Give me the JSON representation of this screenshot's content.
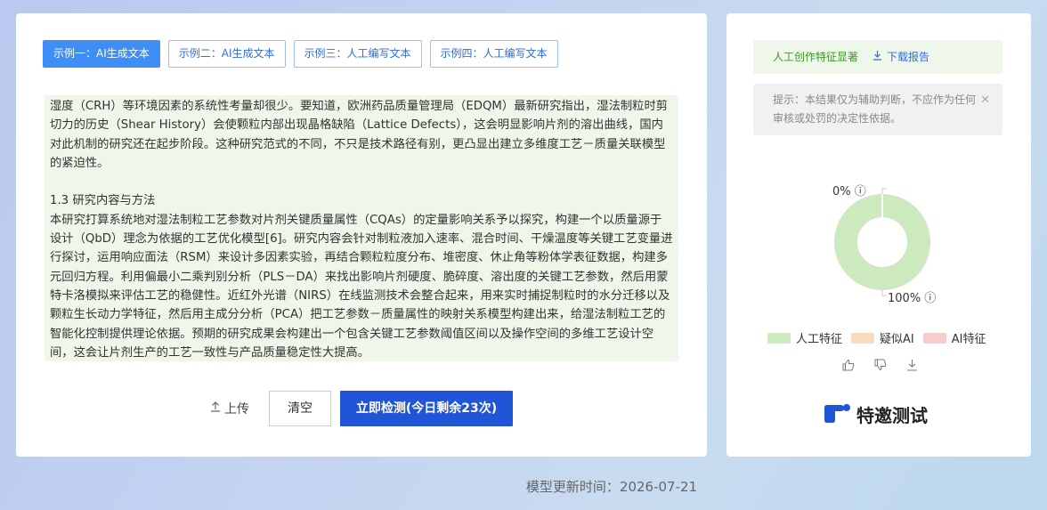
{
  "tabs": [
    {
      "label": "示例一：AI生成文本",
      "active": true
    },
    {
      "label": "示例二：AI生成文本",
      "active": false
    },
    {
      "label": "示例三：人工编写文本",
      "active": false
    },
    {
      "label": "示例四：人工编写文本",
      "active": false
    }
  ],
  "content": {
    "para1": "湿度（CRH）等环境因素的系统性考量却很少。要知道，欧洲药品质量管理局（EDQM）最新研究指出，湿法制粒时剪切力的历史（Shear History）会使颗粒内部出现晶格缺陷（Lattice Defects），这会明显影响片剂的溶出曲线，国内对此机制的研究还在起步阶段。这种研究范式的不同，不只是技术路径有别，更凸显出建立多维度工艺－质量关联模型的紧迫性。",
    "heading": "1.3 研究内容与方法",
    "para2": "本研究打算系统地对湿法制粒工艺参数对片剂关键质量属性（CQAs）的定量影响关系予以探究，构建一个以质量源于设计（QbD）理念为依据的工艺优化模型[6]。研究内容会针对制粒液加入速率、混合时间、干燥温度等关键工艺变量进行探讨，运用响应面法（RSM）来设计多因素实验，再结合颗粒粒度分布、堆密度、休止角等粉体学表征数据，构建多元回归方程。利用偏最小二乘判别分析（PLS－DA）来找出影响片剂硬度、脆碎度、溶出度的关键工艺参数，然后用蒙特卡洛模拟来评估工艺的稳健性。近红外光谱（NIRS）在线监测技术会整合起来，用来实时捕捉制粒时的水分迁移以及颗粒生长动力学特征，然后用主成分分析（PCA）把工艺参数－质量属性的映射关系模型构建出来，给湿法制粒工艺的智能化控制提供理论依据。预期的研究成果会构建出一个包含关键工艺参数阈值区间以及操作空间的多维工艺设计空间，这会让片剂生产的工艺一致性与产品质量稳定性大提高。"
  },
  "actions": {
    "upload_label": "上传",
    "clear_label": "清空",
    "detect_label": "立即检测(今日剩余23次)"
  },
  "result": {
    "banner_label": "人工创作特征显著",
    "download_label": "下载报告",
    "notice": "提示：本结果仅为辅助判断，不应作为任何审核或处罚的决定性依据。"
  },
  "chart_data": {
    "type": "pie",
    "categories": [
      "人工特征",
      "疑似AI",
      "AI特征"
    ],
    "values": [
      100,
      0,
      0
    ],
    "labels": {
      "top": "0% ⓘ",
      "bottom": "100% ⓘ"
    },
    "colors": [
      "#cdeabf",
      "#f7dcc0",
      "#f8cccc"
    ]
  },
  "legend": [
    {
      "label": "人工特征",
      "color": "#cdeabf"
    },
    {
      "label": "疑似AI",
      "color": "#f7dcc0"
    },
    {
      "label": "AI特征",
      "color": "#f8cccc"
    }
  ],
  "brand": {
    "name": "特邀测试",
    "color": "#1f55d6"
  },
  "footer": {
    "update_time": "模型更新时间：2026-07-21"
  }
}
